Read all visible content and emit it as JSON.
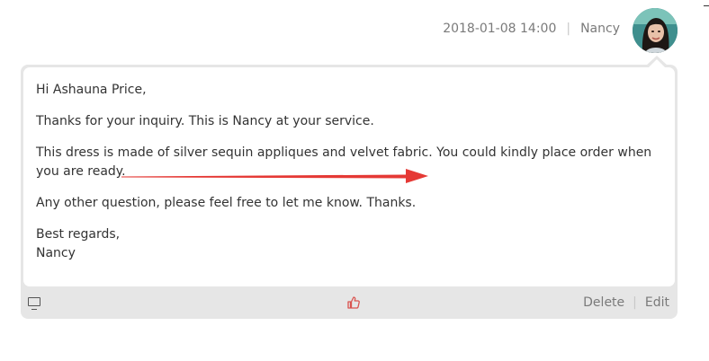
{
  "header": {
    "datetime": "2018-01-08 14:00",
    "author": "Nancy"
  },
  "message": {
    "greeting": "Hi Ashauna Price,",
    "line1": "Thanks for your inquiry. This is Nancy at your service.",
    "line2": "This dress is made of silver sequin appliques and velvet fabric. You could kindly place order when you are ready.",
    "line3": "Any other question, please feel free to let me know. Thanks.",
    "closing": "Best regards,",
    "signature": "Nancy"
  },
  "footer": {
    "delete_label": "Delete",
    "edit_label": "Edit"
  },
  "icons": {
    "device": "monitor-icon",
    "like": "thumbs-up-icon"
  },
  "colors": {
    "card_border": "#e6e6e6",
    "arrow": "#e53935",
    "like": "#d9534f",
    "meta_text": "#7a7a7a"
  }
}
